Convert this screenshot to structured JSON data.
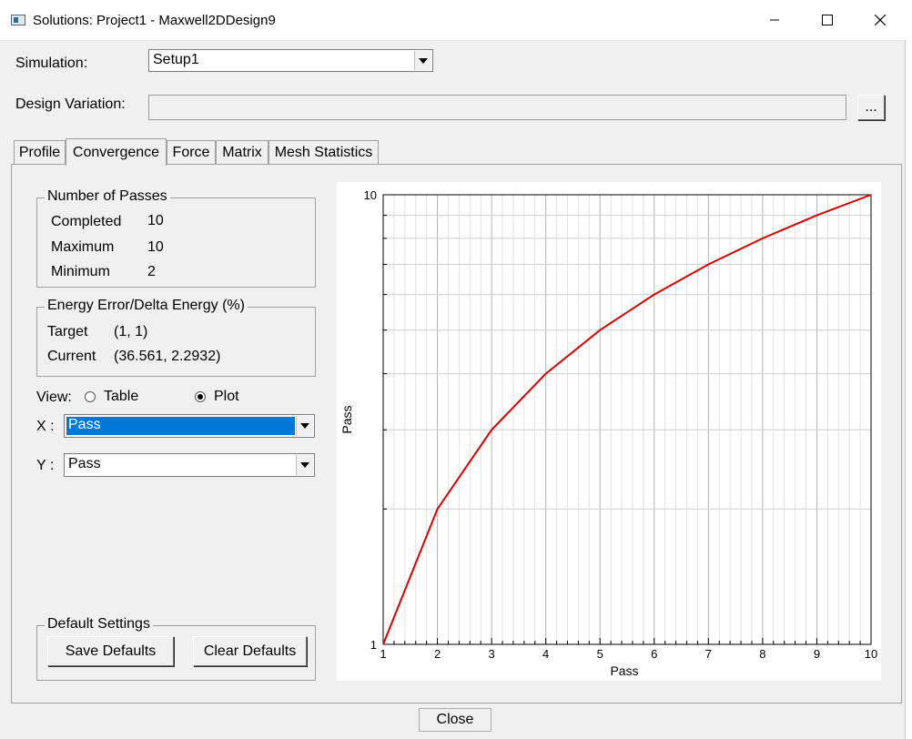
{
  "window": {
    "title": "Solutions: Project1 - Maxwell2DDesign9"
  },
  "simulation": {
    "label": "Simulation:",
    "value": "Setup1"
  },
  "design_variation": {
    "label": "Design Variation:",
    "value": "",
    "browse_label": "..."
  },
  "tabs": [
    {
      "label": "Profile",
      "active": false
    },
    {
      "label": "Convergence",
      "active": true
    },
    {
      "label": "Force",
      "active": false
    },
    {
      "label": "Matrix",
      "active": false
    },
    {
      "label": "Mesh Statistics",
      "active": false
    }
  ],
  "passes": {
    "title": "Number of Passes",
    "completed_label": "Completed",
    "completed_value": "10",
    "maximum_label": "Maximum",
    "maximum_value": "10",
    "minimum_label": "Minimum",
    "minimum_value": "2"
  },
  "energy": {
    "title": "Energy Error/Delta Energy (%)",
    "target_label": "Target",
    "target_value": "(1, 1)",
    "current_label": "Current",
    "current_value": "(36.561, 2.2932)"
  },
  "view": {
    "label": "View:",
    "table_label": "Table",
    "plot_label": "Plot",
    "selected": "Plot"
  },
  "x_select": {
    "label": "X :",
    "value": "Pass"
  },
  "y_select": {
    "label": "Y :",
    "value": "Pass"
  },
  "defaults": {
    "title": "Default Settings",
    "save_label": "Save Defaults",
    "clear_label": "Clear Defaults"
  },
  "close_label": "Close",
  "colors": {
    "series": "#dd0000",
    "selection": "#0078d7",
    "grid": "#c8c8c8"
  },
  "chart_data": {
    "type": "line",
    "xlabel": "Pass",
    "ylabel": "Pass",
    "xlim": [
      1,
      10
    ],
    "ylim": [
      1,
      10
    ],
    "yscale": "log",
    "x_ticks": [
      "1",
      "2",
      "3",
      "4",
      "5",
      "6",
      "7",
      "8",
      "9",
      "10"
    ],
    "y_ticks": [
      "1",
      "10"
    ],
    "grid": true,
    "series": [
      {
        "x": [
          1,
          2,
          3,
          4,
          5,
          6,
          7,
          8,
          9,
          10
        ],
        "y": [
          1,
          2,
          3,
          4,
          5,
          6,
          7,
          8,
          9,
          10
        ]
      }
    ]
  }
}
